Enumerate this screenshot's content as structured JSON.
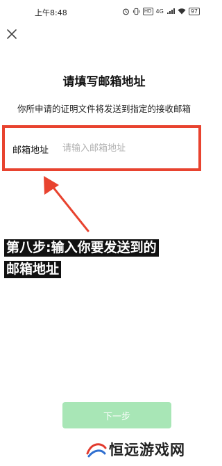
{
  "status_bar": {
    "time": "上午8:48",
    "hd_label": "HD",
    "network_label": "4G",
    "battery_level": "97"
  },
  "header": {
    "title": "请填写邮箱地址",
    "subtitle": "你所申请的证明文件将发送到指定的接收邮箱"
  },
  "form": {
    "email_label": "邮箱地址",
    "email_placeholder": "请输入邮箱地址",
    "email_value": ""
  },
  "annotation": {
    "line1": "第八步:输入你要发送到的",
    "line2": "邮箱地址",
    "highlight_color": "#e8432f"
  },
  "footer": {
    "next_label": "下一步",
    "next_button_color": "#a8e6b6"
  },
  "watermark": {
    "text": "恒远游戏网"
  }
}
